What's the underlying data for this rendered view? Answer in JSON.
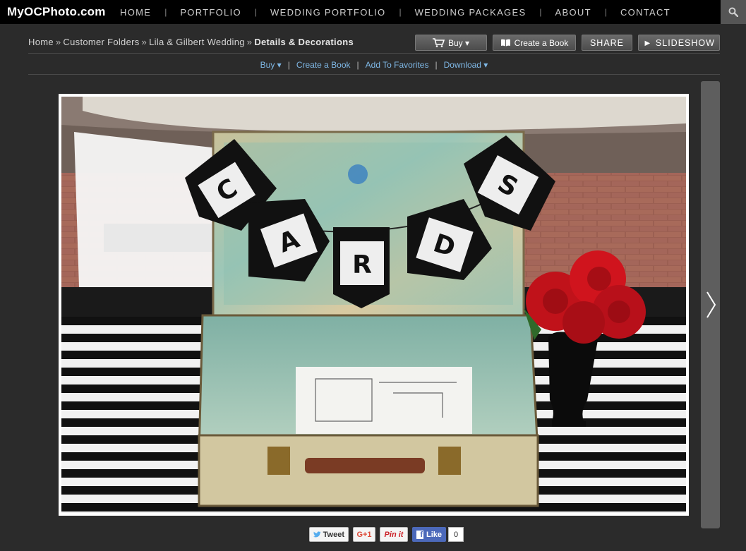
{
  "site": {
    "logo": "MyOCPhoto.com"
  },
  "nav": {
    "items": [
      {
        "label": "HOME"
      },
      {
        "label": "PORTFOLIO"
      },
      {
        "label": "WEDDING PORTFOLIO"
      },
      {
        "label": "WEDDING PACKAGES"
      },
      {
        "label": "ABOUT"
      },
      {
        "label": "CONTACT"
      }
    ],
    "separator": "|",
    "search_icon": "search-icon"
  },
  "breadcrumb": {
    "items": [
      "Home",
      "Customer Folders",
      "Lila & Gilbert Wedding"
    ],
    "current": "Details & Decorations",
    "separator": "»"
  },
  "toolbar": {
    "buy_label": "Buy ▾",
    "book_label": "Create a Book",
    "share_label": "SHARE",
    "slideshow_label": "► SLIDESHOW"
  },
  "actions": {
    "buy": "Buy ▾",
    "book": "Create a Book",
    "favorites": "Add To Favorites",
    "download": "Download ▾",
    "separator": "|"
  },
  "photo": {
    "banner_letters": [
      "C",
      "A",
      "R",
      "D",
      "S"
    ]
  },
  "social": {
    "tweet": "Tweet",
    "gplus": "G+1",
    "pin": "Pin it",
    "like": "Like",
    "like_count": "0"
  },
  "colors": {
    "topbar": "#000000",
    "page_bg": "#2b2b2b",
    "link": "#7fb8e6",
    "facebook": "#4c69ba"
  }
}
